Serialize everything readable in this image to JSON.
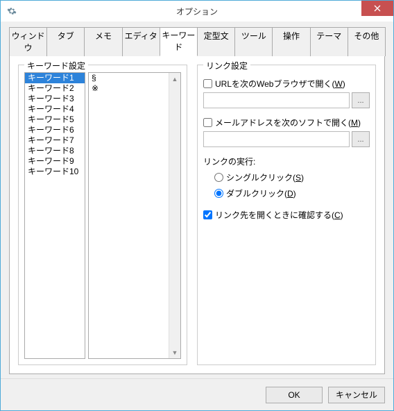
{
  "window": {
    "title": "オプション"
  },
  "tabs": {
    "items": [
      "ウィンドウ",
      "タブ",
      "メモ",
      "エディタ",
      "キーワード",
      "定型文",
      "ツール",
      "操作",
      "テーマ",
      "その他"
    ],
    "active_index": 4
  },
  "keyword_group": {
    "legend": "キーワード設定",
    "list": [
      "キーワード1",
      "キーワード2",
      "キーワード3",
      "キーワード4",
      "キーワード5",
      "キーワード6",
      "キーワード7",
      "キーワード8",
      "キーワード9",
      "キーワード10"
    ],
    "selected_index": 0,
    "symbols": [
      "§",
      "※"
    ]
  },
  "link_group": {
    "legend": "リンク設定",
    "open_browser_label_pre": "URLを次のWebブラウザで開く(",
    "open_browser_key": "W",
    "open_browser_checked": false,
    "browser_path": "",
    "open_mail_label_pre": "メールアドレスを次のソフトで開く(",
    "open_mail_key": "M",
    "open_mail_checked": false,
    "mail_path": "",
    "exec_label": "リンクの実行:",
    "radio_single_pre": "シングルクリック(",
    "radio_single_key": "S",
    "radio_double_pre": "ダブルクリック(",
    "radio_double_key": "D",
    "radio_selected": "double",
    "confirm_label_pre": "リンク先を開くときに確認する(",
    "confirm_key": "C",
    "confirm_checked": true,
    "close_paren": ")"
  },
  "buttons": {
    "ok": "OK",
    "cancel": "キャンセル",
    "browse": "..."
  }
}
